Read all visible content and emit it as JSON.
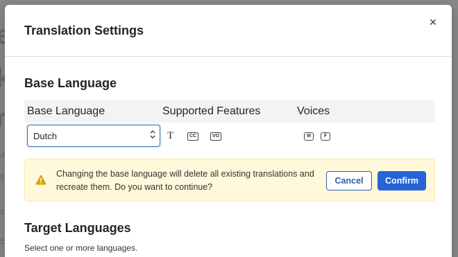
{
  "background": {
    "glyphs": [
      "e",
      "k",
      "r"
    ],
    "fragments": [
      "u",
      "e",
      "e",
      "e"
    ]
  },
  "modal": {
    "title": "Translation Settings",
    "close_symbol": "×"
  },
  "base_section": {
    "title": "Base Language",
    "table": {
      "headers": [
        "Base Language",
        "Supported Features",
        "Voices"
      ]
    },
    "select": {
      "value": "Dutch",
      "caret": "⌃⌄"
    },
    "features": {
      "text_symbol": "T",
      "badges": [
        "CC",
        "VO"
      ]
    },
    "voices": [
      "M",
      "F"
    ]
  },
  "alert": {
    "message": "Changing the base language will delete all existing translations and recreate them. Do you want to continue?",
    "cancel_label": "Cancel",
    "confirm_label": "Confirm",
    "icon": "warning-icon",
    "warning_color": "#e0a100"
  },
  "target_section": {
    "title": "Target Languages",
    "hint": "Select one or more languages."
  },
  "colors": {
    "primary": "#2563d9",
    "alert_bg": "#fff8db",
    "overlay": "#7d7d7d"
  }
}
